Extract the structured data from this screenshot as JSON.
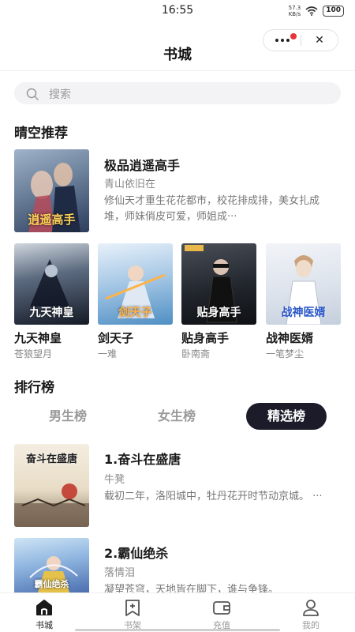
{
  "status": {
    "time": "16:55",
    "net_speed_value": "57.3",
    "net_speed_unit": "KB/s",
    "battery": "100"
  },
  "header": {
    "title": "书城"
  },
  "search": {
    "placeholder": "搜索"
  },
  "sections": {
    "recommend": "晴空推荐",
    "ranking": "排行榜"
  },
  "featured": {
    "title": "极品逍遥高手",
    "author": "青山依旧在",
    "description": "修仙天才重生花花都市，校花排成排，美女扎成堆，师妹俏皮可爱，师姐成···",
    "cover_text": "逍遥高手"
  },
  "grid_books": [
    {
      "title": "九天神皇",
      "author": "苍狼望月",
      "cover_text": "九天神皇"
    },
    {
      "title": "剑天子",
      "author": "一难",
      "cover_text": "剑天子"
    },
    {
      "title": "贴身高手",
      "author": "卧南斋",
      "cover_text": "贴身高手"
    },
    {
      "title": "战神医婿",
      "author": "一笔梦尘",
      "cover_text": "战神医婿"
    }
  ],
  "rank_tabs": [
    {
      "label": "男生榜",
      "active": false
    },
    {
      "label": "女生榜",
      "active": false
    },
    {
      "label": "精选榜",
      "active": true
    }
  ],
  "rank_list": [
    {
      "title": "1.奋斗在盛唐",
      "author": "牛凳",
      "description": "载初二年，洛阳城中，牡丹花开时节动京城。    ···",
      "cover_text": "奋斗在盛唐"
    },
    {
      "title": "2.霸仙绝杀",
      "author": "落情泪",
      "description": "凝望苍穹，天地皆在脚下，谁与争锋。",
      "cover_text": "霸仙绝杀"
    }
  ],
  "bottom_nav": [
    {
      "label": "书城",
      "icon": "home-icon",
      "active": true
    },
    {
      "label": "书架",
      "icon": "bookmark-icon",
      "active": false
    },
    {
      "label": "充值",
      "icon": "wallet-icon",
      "active": false
    },
    {
      "label": "我的",
      "icon": "user-icon",
      "active": false
    }
  ],
  "colors": {
    "accent_dark": "#1b1b2a",
    "badge_red": "#e5363b",
    "muted_text": "#888888"
  }
}
